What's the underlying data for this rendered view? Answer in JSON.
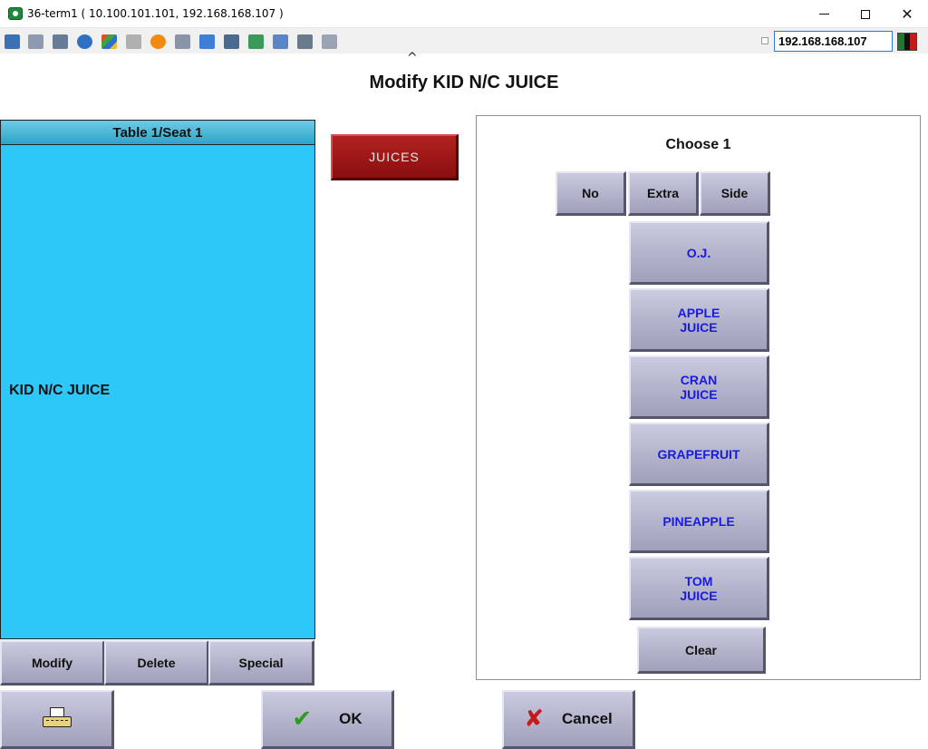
{
  "window": {
    "title": "36-term1 ( 10.100.101.101, 192.168.168.107 )",
    "minimize_glyph": "",
    "close_glyph": "✕"
  },
  "toolbar": {
    "icons": [
      "monitor-icon",
      "windows-icon",
      "tools-icon",
      "refresh-icon",
      "windows-flag-icon",
      "keyboard-icon",
      "alert-icon",
      "network-icon",
      "fullscreen-icon",
      "display-icon",
      "transfer-icon",
      "file-icon",
      "screen-icon",
      "chat-icon"
    ],
    "server_ip": "192.168.168.107",
    "collapse_glyph": "^"
  },
  "page": {
    "title": "Modify KID N/C JUICE"
  },
  "seat": {
    "header": "Table 1/Seat 1",
    "items": [
      "KID N/C JUICE"
    ]
  },
  "seat_actions": {
    "modify": "Modify",
    "delete": "Delete",
    "special": "Special"
  },
  "category": {
    "label": "JUICES"
  },
  "modifiers": {
    "title": "Choose 1",
    "prefixes": [
      "No",
      "Extra",
      "Side"
    ],
    "options": [
      "O.J.",
      "APPLE\nJUICE",
      "CRAN\nJUICE",
      "GRAPEFRUIT",
      "PINEAPPLE",
      "TOM\nJUICE"
    ],
    "clear": "Clear"
  },
  "footer": {
    "ok": "OK",
    "cancel": "Cancel"
  },
  "colors": {
    "seat_list": "#2ec8f8",
    "category_button": "#a01919",
    "choice_text": "#1a1ae6",
    "ok_check": "#2f9b1f",
    "cancel_x": "#c41a1a"
  }
}
